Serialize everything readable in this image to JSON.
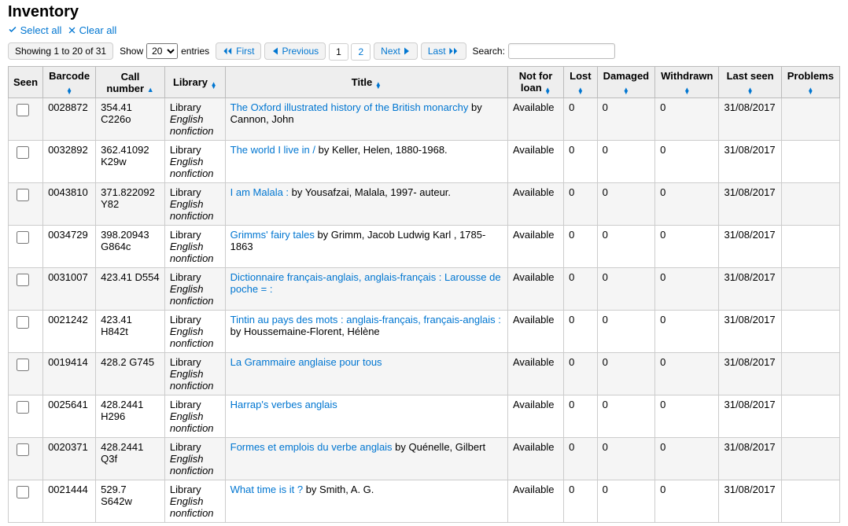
{
  "page": {
    "heading": "Inventory",
    "select_all": "Select all",
    "clear_all": "Clear all"
  },
  "controls": {
    "info": "Showing 1 to 20 of 31",
    "show_label": "Show",
    "entries_label": "entries",
    "page_length": "20",
    "first": "First",
    "previous": "Previous",
    "next": "Next",
    "last": "Last",
    "search_label": "Search:",
    "pages": [
      "1",
      "2"
    ],
    "current_page": 1
  },
  "columns": {
    "seen": "Seen",
    "barcode": "Barcode",
    "callnum": "Call number",
    "library": "Library",
    "title": "Title",
    "not_for_loan": "Not for loan",
    "lost": "Lost",
    "damaged": "Damaged",
    "withdrawn": "Withdrawn",
    "last_seen": "Last seen",
    "problems": "Problems"
  },
  "library_main": "Library",
  "library_sub": "English nonfiction",
  "rows": [
    {
      "barcode": "0028872",
      "callnum": "354.41 C226o",
      "title_link": "The Oxford illustrated history of the British monarchy",
      "title_rest": " by Cannon, John",
      "status": "Available",
      "lost": "0",
      "damaged": "0",
      "withdrawn": "0",
      "lastseen": "31/08/2017"
    },
    {
      "barcode": "0032892",
      "callnum": "362.41092 K29w",
      "title_link": "The world I live in /",
      "title_rest": " by Keller, Helen, 1880-1968.",
      "status": "Available",
      "lost": "0",
      "damaged": "0",
      "withdrawn": "0",
      "lastseen": "31/08/2017"
    },
    {
      "barcode": "0043810",
      "callnum": "371.822092 Y82",
      "title_link": "I am Malala :",
      "title_rest": " by Yousafzai, Malala, 1997- auteur.",
      "status": "Available",
      "lost": "0",
      "damaged": "0",
      "withdrawn": "0",
      "lastseen": "31/08/2017"
    },
    {
      "barcode": "0034729",
      "callnum": "398.20943 G864c",
      "title_link": "Grimms' fairy tales",
      "title_rest": " by Grimm, Jacob Ludwig Karl , 1785-1863",
      "status": "Available",
      "lost": "0",
      "damaged": "0",
      "withdrawn": "0",
      "lastseen": "31/08/2017"
    },
    {
      "barcode": "0031007",
      "callnum": "423.41 D554",
      "title_link": "Dictionnaire français-anglais, anglais-français : Larousse de poche = :",
      "title_rest": "",
      "status": "Available",
      "lost": "0",
      "damaged": "0",
      "withdrawn": "0",
      "lastseen": "31/08/2017"
    },
    {
      "barcode": "0021242",
      "callnum": "423.41 H842t",
      "title_link": "Tintin au pays des mots : anglais-français, français-anglais :",
      "title_rest": " by Houssemaine-Florent, Hélène",
      "status": "Available",
      "lost": "0",
      "damaged": "0",
      "withdrawn": "0",
      "lastseen": "31/08/2017"
    },
    {
      "barcode": "0019414",
      "callnum": "428.2 G745",
      "title_link": "La Grammaire anglaise pour tous",
      "title_rest": "",
      "status": "Available",
      "lost": "0",
      "damaged": "0",
      "withdrawn": "0",
      "lastseen": "31/08/2017"
    },
    {
      "barcode": "0025641",
      "callnum": "428.2441 H296",
      "title_link": "Harrap's verbes anglais",
      "title_rest": "",
      "status": "Available",
      "lost": "0",
      "damaged": "0",
      "withdrawn": "0",
      "lastseen": "31/08/2017"
    },
    {
      "barcode": "0020371",
      "callnum": "428.2441 Q3f",
      "title_link": "Formes et emplois du verbe anglais",
      "title_rest": " by Quénelle, Gilbert",
      "status": "Available",
      "lost": "0",
      "damaged": "0",
      "withdrawn": "0",
      "lastseen": "31/08/2017"
    },
    {
      "barcode": "0021444",
      "callnum": "529.7 S642w",
      "title_link": "What time is it ?",
      "title_rest": " by Smith, A. G.",
      "status": "Available",
      "lost": "0",
      "damaged": "0",
      "withdrawn": "0",
      "lastseen": "31/08/2017"
    }
  ]
}
